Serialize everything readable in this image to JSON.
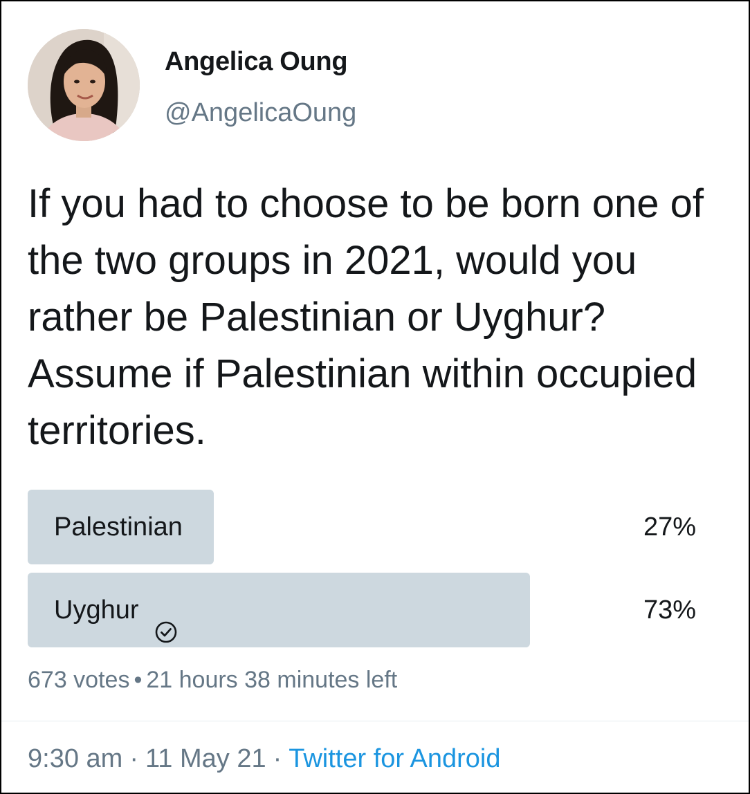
{
  "author": {
    "display_name": "Angelica Oung",
    "handle": "@AngelicaOung",
    "avatar_icon": "profile-photo"
  },
  "tweet": {
    "text": "If you had to choose to be born one of the two groups in 2021, would you rather be Palestinian or Uyghur? Assume if Palestinian within occupied territories."
  },
  "poll": {
    "options": [
      {
        "label": "Palestinian",
        "percent_text": "27%",
        "percent": 27,
        "selected": false
      },
      {
        "label": "Uyghur",
        "percent_text": "73%",
        "percent": 73,
        "selected": true,
        "icon": "check-circle-icon"
      }
    ],
    "votes": "673 votes",
    "separator": "•",
    "time_left": "21 hours 38 minutes left",
    "bar_color": "#cdd8df"
  },
  "footer": {
    "time": "9:30 am",
    "separator": "·",
    "date": "11 May 21",
    "source": "Twitter for Android"
  },
  "colors": {
    "text": "#14171a",
    "secondary": "#657786",
    "link": "#1b95e0"
  }
}
